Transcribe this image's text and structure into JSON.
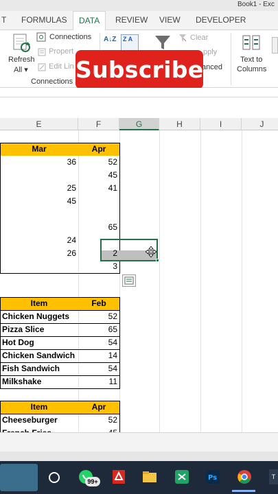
{
  "window": {
    "title": "Book1 - Exc"
  },
  "ribbon": {
    "tabs": [
      "T",
      "FORMULAS",
      "DATA",
      "REVIEW",
      "VIEW",
      "DEVELOPER"
    ],
    "active_tab": "DATA",
    "refresh_all": "Refresh All ▾",
    "refresh_all_line1": "Refresh",
    "refresh_all_line2": "All ▾",
    "connections": "Connections",
    "properties": "Propert",
    "edit_links": "Edit Lin",
    "group_connections": "Connections",
    "clear": "Clear",
    "reapply": "pply",
    "advanced": "anced",
    "text_to_columns_line1": "Text to",
    "text_to_columns_line2": "Columns",
    "sort_az": "A↓Z",
    "sort_za": "Z A"
  },
  "overlay": {
    "subscribe": "Subscribe"
  },
  "columns": [
    {
      "label": "E",
      "selected": false
    },
    {
      "label": "F",
      "selected": false
    },
    {
      "label": "G",
      "selected": true
    },
    {
      "label": "H",
      "selected": false
    },
    {
      "label": "I",
      "selected": false
    },
    {
      "label": "J",
      "selected": false
    }
  ],
  "table1": {
    "headers": [
      "Mar",
      "Apr"
    ],
    "rows": [
      [
        "36",
        "52"
      ],
      [
        "",
        "45"
      ],
      [
        "25",
        "41"
      ],
      [
        "45",
        ""
      ],
      [
        "",
        ""
      ],
      [
        "",
        "65"
      ],
      [
        "24",
        ""
      ],
      [
        "26",
        "2"
      ],
      [
        "",
        "3"
      ]
    ]
  },
  "table2": {
    "headers": [
      "Item",
      "Feb"
    ],
    "rows": [
      [
        "Chicken Nuggets",
        "52"
      ],
      [
        "Pizza Slice",
        "65"
      ],
      [
        "Hot Dog",
        "54"
      ],
      [
        "Chicken Sandwich",
        "14"
      ],
      [
        "Fish Sandwich",
        "54"
      ],
      [
        "Milkshake",
        "11"
      ]
    ]
  },
  "table3": {
    "headers": [
      "Item",
      "Apr"
    ],
    "rows": [
      [
        "Cheeseburger",
        "52"
      ],
      [
        "French Fries",
        "45"
      ]
    ]
  },
  "taskbar": {
    "whatsapp_badge": "99+",
    "edge_label": "T"
  },
  "colors": {
    "excel_green": "#217346",
    "header_fill": "#ffc000",
    "subscribe_red": "#e0221c",
    "taskbar": "#1e2a3a"
  }
}
